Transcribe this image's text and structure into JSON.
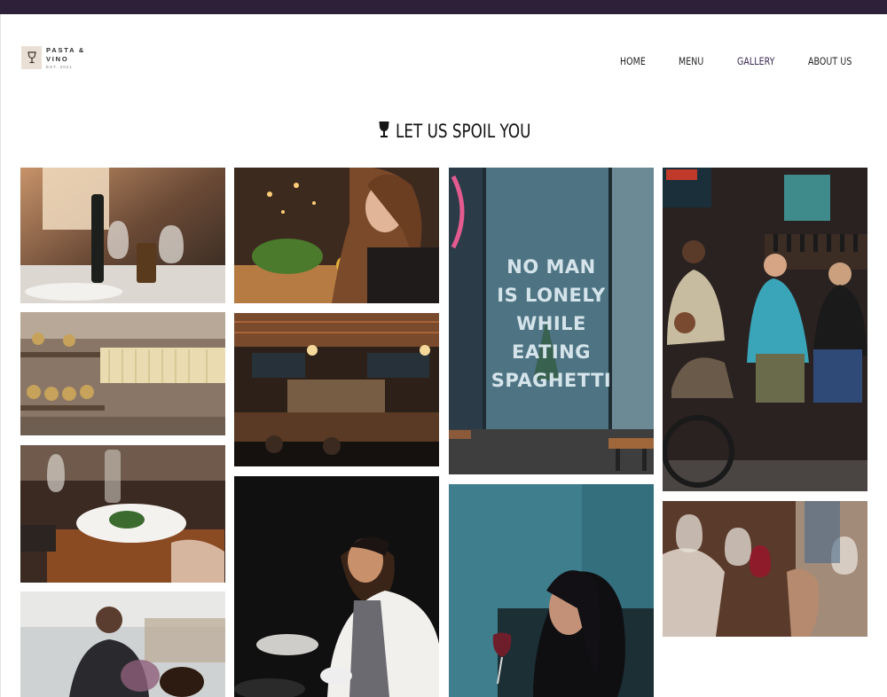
{
  "brand": {
    "line1": "PASTA &",
    "line2": "VINO",
    "est": "EST. 2021"
  },
  "nav": {
    "items": [
      "HOME",
      "MENU",
      "GALLERY",
      "ABOUT US"
    ],
    "active_index": 2
  },
  "section": {
    "heading": "LET US SPOIL YOU",
    "icon": "wine-glass-icon"
  },
  "gallery": {
    "storefront_caption": [
      "NO MAN",
      "IS LONELY",
      "WHILE",
      "EATING",
      "SPAGHETTI"
    ]
  },
  "colors": {
    "topbar": "#2e2038",
    "accent": "#3b2a52",
    "heading": "#121212",
    "logo_badge": "#eadfd5"
  }
}
